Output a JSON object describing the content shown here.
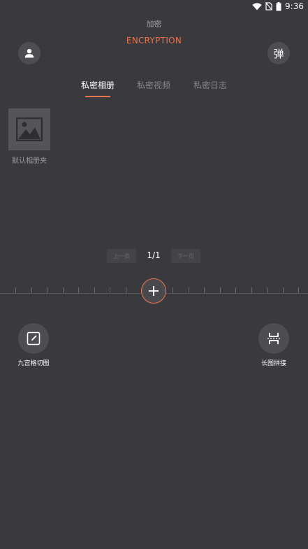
{
  "status_bar": {
    "time": "9:36",
    "icons": [
      "wifi-icon",
      "no-sim-icon",
      "battery-icon"
    ]
  },
  "header": {
    "subtitle": "加密",
    "title": "ENCRYPTION",
    "left_icon": "user-icon",
    "right_button_label": "弹"
  },
  "tabs": [
    {
      "label": "私密相册",
      "active": true
    },
    {
      "label": "私密视频",
      "active": false
    },
    {
      "label": "私密日志",
      "active": false
    }
  ],
  "albums": [
    {
      "label": "默认相册夹",
      "icon": "image-placeholder-icon"
    }
  ],
  "pager": {
    "prev_label": "上一页",
    "indicator": "1/1",
    "next_label": "下一页"
  },
  "add_button": {
    "icon": "plus-icon"
  },
  "tools": [
    {
      "label": "九宫格切图",
      "icon": "edit-pen-icon"
    },
    {
      "label": "长图拼接",
      "icon": "stitch-icon"
    }
  ],
  "colors": {
    "background": "#3a3a3e",
    "accent": "#e8744f",
    "circle_button": "#4e4e52"
  }
}
